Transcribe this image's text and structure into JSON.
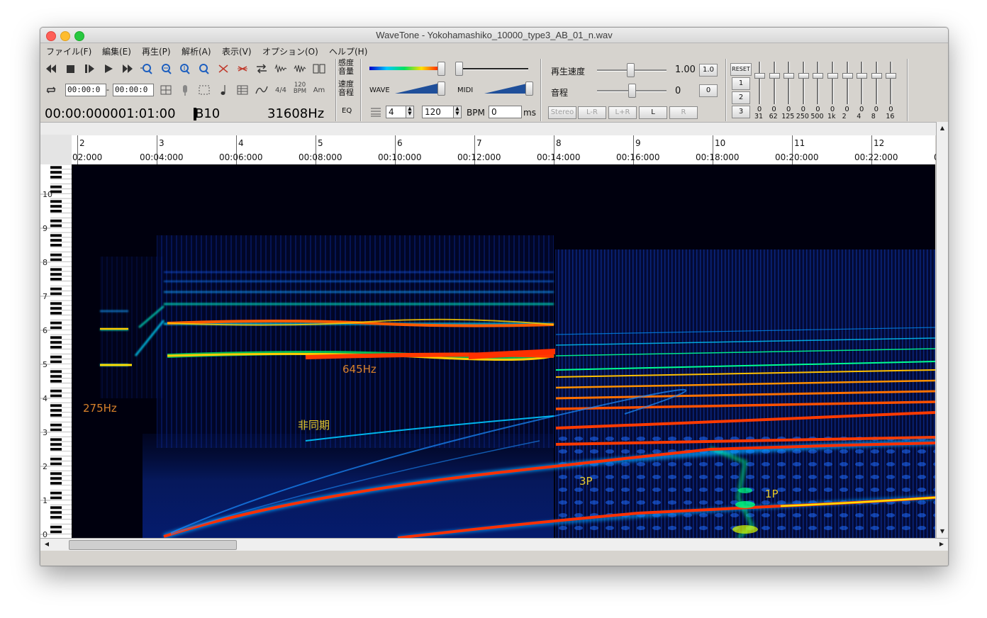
{
  "window": {
    "title": "WaveTone - Yokohamashiko_10000_type3_AB_01_n.wav"
  },
  "menu": [
    "ファイル(F)",
    "編集(E)",
    "再生(P)",
    "解析(A)",
    "表示(V)",
    "オプション(O)",
    "ヘルプ(H)"
  ],
  "toolbar": {
    "time_start": "00:00:0",
    "time_end": "00:00:0",
    "meter_label": "4/4",
    "bpm_icon_top": "120",
    "bpm_icon_bottom": "BPM",
    "chord_label": "Am"
  },
  "readout": {
    "position": "00:00:000001:01:00",
    "note": "B10",
    "frequency": "31608Hz"
  },
  "panel": {
    "sens_label": "感度",
    "volume_label": "音量",
    "speed_label": "速度",
    "pitch_label": "音程",
    "eq_label": "EQ",
    "wave_label": "WAVE",
    "midi_label": "MIDI",
    "beats_value": "4",
    "bpm_value": "120",
    "bpm_label": "BPM",
    "ms_value": "0",
    "ms_label": "ms"
  },
  "playback": {
    "speed_label": "再生速度",
    "speed_value": "1.00",
    "speed_reset": "1.0",
    "pitch_label": "音程",
    "pitch_value": "0",
    "pitch_reset": "0",
    "channels": [
      "Stereo",
      "L-R",
      "L+R",
      "L",
      "R"
    ]
  },
  "eq": {
    "reset": "RESET",
    "presets": [
      "1",
      "2",
      "3"
    ],
    "bands": [
      {
        "value": "0",
        "label": "31"
      },
      {
        "value": "0",
        "label": "62"
      },
      {
        "value": "0",
        "label": "125"
      },
      {
        "value": "0",
        "label": "250"
      },
      {
        "value": "0",
        "label": "500"
      },
      {
        "value": "0",
        "label": "1k"
      },
      {
        "value": "0",
        "label": "2"
      },
      {
        "value": "0",
        "label": "4"
      },
      {
        "value": "0",
        "label": "8"
      },
      {
        "value": "0",
        "label": "16"
      }
    ]
  },
  "ruler": {
    "measures": [
      "2",
      "3",
      "4",
      "5",
      "6",
      "7",
      "8",
      "9",
      "10",
      "11",
      "12"
    ],
    "times": [
      "02:000",
      "00:04:000",
      "00:06:000",
      "00:08:000",
      "00:10:000",
      "00:12:000",
      "00:14:000",
      "00:16:000",
      "00:18:000",
      "00:20:000",
      "00:22:000",
      "0"
    ]
  },
  "keyboard": {
    "octaves": [
      "0",
      "1",
      "2",
      "3",
      "4",
      "5",
      "6",
      "7",
      "8",
      "9",
      "10"
    ]
  },
  "annotations": {
    "f275": "275Hz",
    "f645": "645Hz",
    "async": "非同期",
    "p3": "3P",
    "p1": "1P"
  },
  "colors": {
    "orange_annotation": "#d9822b",
    "yellow_annotation": "#e6c92a",
    "spectrogram_bg": "#000010"
  }
}
